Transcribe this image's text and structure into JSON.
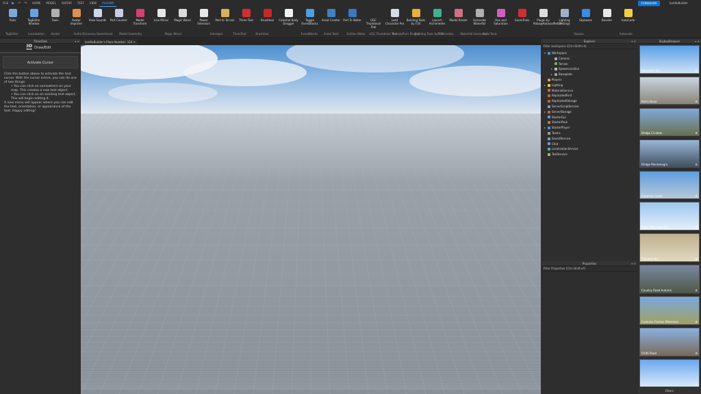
{
  "menu": {
    "file": "FILE",
    "tabs": [
      "HOME",
      "MODEL",
      "AVATAR",
      "TEST",
      "VIEW",
      "PLUGINS"
    ],
    "active": "PLUGINS",
    "collaborate": "Collaborate",
    "user": "IamRoBuilder"
  },
  "ribbon": {
    "buttons": [
      {
        "label": "Tools",
        "color": "#7fa8d8"
      },
      {
        "label": "TagEditor Window",
        "color": "#6aa0e0"
      },
      {
        "label": "Tools",
        "color": "#b0b0b0"
      },
      {
        "label": "Avatar Importer",
        "color": "#e09050"
      },
      {
        "label": "View Sounds",
        "color": "#cfd6e6"
      },
      {
        "label": "Part Counter",
        "color": "#c8cde6"
      },
      {
        "label": "Model Transform",
        "color": "#d04070"
      },
      {
        "label": "Line Mirror",
        "color": "#e6e6e6"
      },
      {
        "label": "Magic Wand",
        "color": "#dcdcdc"
      },
      {
        "label": "Power Selectors",
        "color": "#e8e8e8"
      },
      {
        "label": "Part to Terrain",
        "color": "#d8b060"
      },
      {
        "label": "Three Text",
        "color": "#d03030"
      },
      {
        "label": "Brushtool",
        "color": "#c82828"
      },
      {
        "label": "Celestial Body Dragger",
        "color": "#f2f2f2"
      },
      {
        "label": "Toggle EventBlocks",
        "color": "#4aa0e0"
      },
      {
        "label": "Asset Creator",
        "color": "#4080c0"
      },
      {
        "label": "Part To Water",
        "color": "#3a78c0"
      },
      {
        "label": "UGC Thumbnail Tool",
        "color": "#2b2b2b"
      },
      {
        "label": "Load Character Pro",
        "color": "#d8dce6"
      },
      {
        "label": "Building Tools by F3X",
        "color": "#e8b040"
      },
      {
        "label": "Launch Archimedes",
        "color": "#40b090"
      },
      {
        "label": "Model Resize",
        "color": "#d07080"
      },
      {
        "label": "Generate Waterfall",
        "color": "#b0b0b0"
      },
      {
        "label": "Hue and Saturation",
        "color": "#d060c0"
      },
      {
        "label": "GeomTools",
        "color": "#d03030"
      },
      {
        "label": "Plugin by Robo@RoboxalRetLP",
        "color": "#dcdcdc"
      },
      {
        "label": "Lighting Settings",
        "color": "#a0b0c8"
      },
      {
        "label": "Skyboxes",
        "color": "#3b8be0"
      },
      {
        "label": "Beveler",
        "color": "#e8e8e8"
      },
      {
        "label": "AutoCode",
        "color": "#f0d040"
      }
    ],
    "groups": [
      "TagEditor",
      "Localization",
      "Avatar",
      "Audio Discovery",
      "GameAssist",
      "Model Geometry",
      "",
      "Magic Wand",
      "",
      "Interapol",
      "ThreeText",
      "Brushtool",
      "",
      "EventBlocks",
      "Asset Tools",
      "Outline Water",
      "UGC Thumbnail Tool",
      "AlreadyPro's Plugins",
      "Building Tools by F3X",
      "Archimedes",
      "Waterfall Generator",
      "ColorTools",
      "",
      "",
      "",
      "Skybox",
      "",
      "Autocode"
    ]
  },
  "left": {
    "title": "ThreeText",
    "logo_top": "3D",
    "logo_bottom": "text",
    "mode": "Draw/Edit",
    "button": "Activate Cursor",
    "instructions": [
      "Click the button above to activate the text cursor. With the cursor active, you can do one of two things:",
      "• You can click on somewhere on your map. This creates a new text object.",
      "• You can click on an existing text object. This will begin editing it.",
      "A new menu will appear where you can edit the text, orientation, or appearance of the text. Happy editing!"
    ]
  },
  "doc_tab": "IamRoBuilder's Place Number: 124",
  "explorer": {
    "title": "Explorer",
    "filter": "Filter workspace (Ctrl+Shift+X)",
    "items": [
      {
        "label": "Workspace",
        "indent": 0,
        "arrow": "▾",
        "color": "#4f8fe0"
      },
      {
        "label": "Camera",
        "indent": 2,
        "arrow": "",
        "color": "#9ab0d0"
      },
      {
        "label": "Terrain",
        "indent": 2,
        "arrow": "",
        "color": "#80b060"
      },
      {
        "label": "SpawnLocation",
        "indent": 2,
        "arrow": "▸",
        "color": "#c0c0c0"
      },
      {
        "label": "Baseplate",
        "indent": 2,
        "arrow": "▸",
        "color": "#a0a0a0"
      },
      {
        "label": "Players",
        "indent": 0,
        "arrow": "",
        "color": "#e0a050"
      },
      {
        "label": "Lighting",
        "indent": 0,
        "arrow": "▸",
        "color": "#f0d040"
      },
      {
        "label": "MaterialService",
        "indent": 0,
        "arrow": "",
        "color": "#e06060"
      },
      {
        "label": "ReplicatedFirst",
        "indent": 0,
        "arrow": "",
        "color": "#d06040"
      },
      {
        "label": "ReplicatedStorage",
        "indent": 0,
        "arrow": "",
        "color": "#d06040"
      },
      {
        "label": "ServerScriptService",
        "indent": 0,
        "arrow": "",
        "color": "#70a0e0"
      },
      {
        "label": "ServerStorage",
        "indent": 0,
        "arrow": "▸",
        "color": "#d06040"
      },
      {
        "label": "StarterGui",
        "indent": 0,
        "arrow": "",
        "color": "#60a0d0"
      },
      {
        "label": "StarterPack",
        "indent": 0,
        "arrow": "",
        "color": "#c08040"
      },
      {
        "label": "StarterPlayer",
        "indent": 0,
        "arrow": "▸",
        "color": "#4f8fe0"
      },
      {
        "label": "Teams",
        "indent": 0,
        "arrow": "",
        "color": "#a0a0a0"
      },
      {
        "label": "SoundService",
        "indent": 0,
        "arrow": "",
        "color": "#70a0e0"
      },
      {
        "label": "Chat",
        "indent": 0,
        "arrow": "",
        "color": "#9090d0"
      },
      {
        "label": "LocalizationService",
        "indent": 0,
        "arrow": "",
        "color": "#60b0b0"
      },
      {
        "label": "TestService",
        "indent": 0,
        "arrow": "",
        "color": "#a0c060"
      }
    ]
  },
  "properties": {
    "title": "Properties",
    "filter": "Filter Properties (Ctrl+Shift+P)"
  },
  "skybox": {
    "title": "SkyboxBrowser",
    "filter": "Filters",
    "items": [
      {
        "label": "Afternoon Sky",
        "top": "#5aa0e8",
        "bottom": "#cfe2f3"
      },
      {
        "label": "Bafra Dune",
        "top": "#c8d4e0",
        "bottom": "#8a8478"
      },
      {
        "label": "Bridge Cividale",
        "top": "#7fa8d8",
        "bottom": "#6a7050"
      },
      {
        "label": "Bridge Montenegro",
        "top": "#9ab6d8",
        "bottom": "#405060"
      },
      {
        "label": "Canarian Coast",
        "top": "#5e9ee0",
        "bottom": "#b8c8d8"
      },
      {
        "label": "Clear Afternoon Sky",
        "top": "#9cc6f0",
        "bottom": "#e6f0fa"
      },
      {
        "label": "Clouded Sky",
        "top": "#c0b090",
        "bottom": "#e0d8c0"
      },
      {
        "label": "Country Road Autumn",
        "top": "#7888a0",
        "bottom": "#505848"
      },
      {
        "label": "Cumulus Fractus Afternoon",
        "top": "#78a8e0",
        "bottom": "#a0a060"
      },
      {
        "label": "D106 Road",
        "top": "#8ab0e0",
        "bottom": "#7a6a58"
      },
      {
        "label": "",
        "top": "#6aa8f0",
        "bottom": "#d8e8f8"
      }
    ]
  }
}
